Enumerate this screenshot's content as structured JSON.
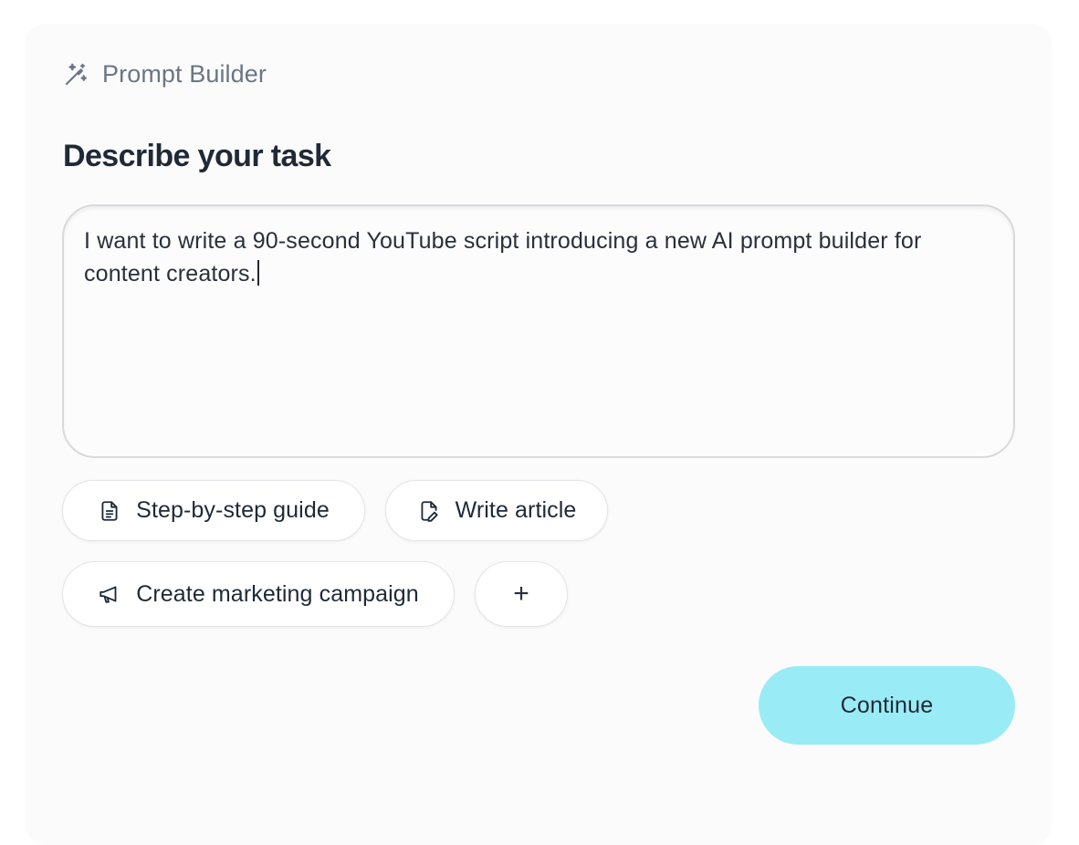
{
  "app": {
    "title": "Prompt Builder",
    "icon": "magic-wand-icon"
  },
  "main": {
    "heading": "Describe your task",
    "task_input": {
      "value": "I want to write a 90-second YouTube script introducing a new AI prompt builder for content creators."
    },
    "suggestions": [
      {
        "label": "Step-by-step guide",
        "icon": "document-list-icon"
      },
      {
        "label": "Write article",
        "icon": "file-edit-icon"
      },
      {
        "label": "Create marketing campaign",
        "icon": "megaphone-icon"
      },
      {
        "label": "+",
        "icon": "plus-icon"
      }
    ],
    "continue_label": "Continue"
  },
  "colors": {
    "accent": "#99ecf5",
    "heading": "#1f2937",
    "muted": "#6b7684",
    "panel_bg": "#fbfbfc"
  }
}
